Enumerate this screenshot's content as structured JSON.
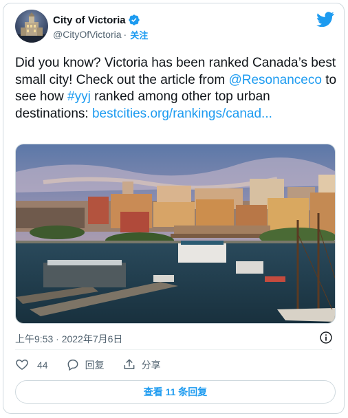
{
  "author": {
    "name": "City of Victoria",
    "handle": "@CityOfVictoria",
    "separator": "·",
    "follow_label": "关注"
  },
  "tweet": {
    "text_1": "Did you know? Victoria has been ranked Canada’s best small city! Check out the article from ",
    "mention": "@Resonanceco",
    "text_2": " to see how ",
    "hashtag": "#yyj",
    "text_3": " ranked among other top urban destinations: ",
    "url": "bestcities.org/rankings/canad..."
  },
  "timestamp": "上午9:53 · 2022年7月6日",
  "actions": {
    "like_count": "44",
    "reply_label": "回复",
    "share_label": "分享"
  },
  "replies_button": "查看 11 条回复",
  "colors": {
    "accent": "#1d9bf0",
    "text": "#0f1419",
    "secondary": "#536471",
    "border": "#cfd9de"
  },
  "icons": [
    "twitter-bird-icon",
    "verified-badge-icon",
    "info-icon",
    "heart-icon",
    "reply-bubble-icon",
    "share-icon"
  ]
}
